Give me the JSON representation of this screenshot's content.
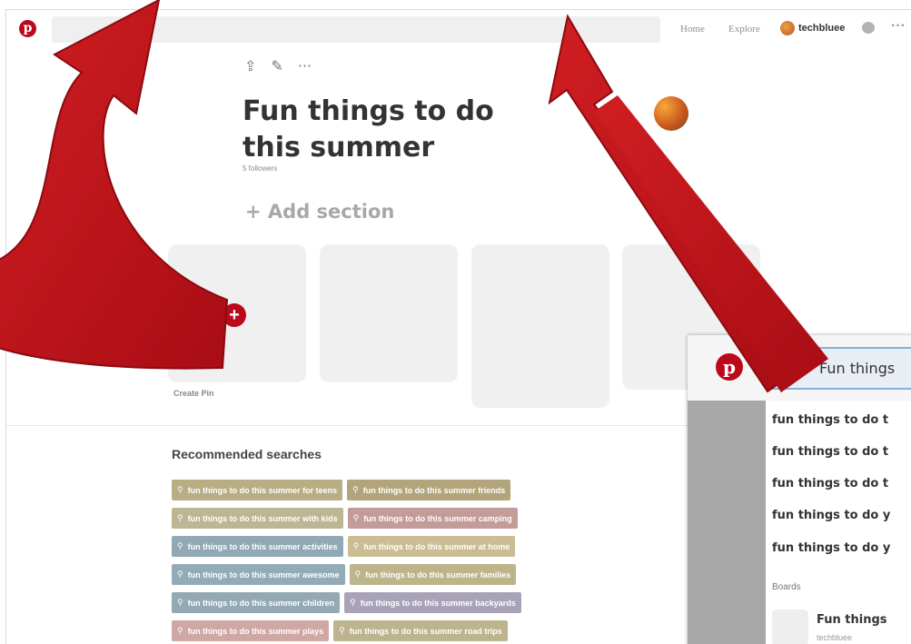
{
  "nav": {
    "logo_glyph": "p",
    "home": "Home",
    "explore": "Explore",
    "username": "techbluee",
    "more": "···"
  },
  "board": {
    "tools": [
      "⇪",
      "✎",
      "···"
    ],
    "title": "Fun things to do this summer",
    "followers": "5 followers",
    "add_section": "+ Add section",
    "create_pin": "Create Pin",
    "add_glyph": "+"
  },
  "recommended": {
    "title": "Recommended searches",
    "search_glyph": "⚲",
    "rows": [
      [
        {
          "label": "fun things to do this summer for teens",
          "color": "#b9ad84"
        },
        {
          "label": "fun things to do this summer friends",
          "color": "#b3a57b"
        }
      ],
      [
        {
          "label": "fun things to do this summer with kids",
          "color": "#bcb692"
        },
        {
          "label": "fun things to do this summer camping",
          "color": "#c39b98"
        }
      ],
      [
        {
          "label": "fun things to do this summer activities",
          "color": "#90a9b5"
        },
        {
          "label": "fun things to do this summer at home",
          "color": "#cbbd93"
        }
      ],
      [
        {
          "label": "fun things to do this summer awesome",
          "color": "#93abb6"
        },
        {
          "label": "fun things to do this summer families",
          "color": "#bcb48a"
        }
      ],
      [
        {
          "label": "fun things to do this summer children",
          "color": "#93a9b3"
        },
        {
          "label": "fun things to do this summer backyards",
          "color": "#a9a3b9"
        }
      ],
      [
        {
          "label": "fun things to do this summer plays",
          "color": "#cfa7a3"
        },
        {
          "label": "fun things to do this summer road trips",
          "color": "#bcb48c"
        }
      ]
    ]
  },
  "inset": {
    "logo_glyph": "p",
    "search_text": "Fun things",
    "suggestions": [
      "fun things to do t",
      "fun things to do t",
      "fun things to do t",
      "fun things to do y",
      "fun things to do y"
    ],
    "boards_label": "Boards",
    "board_name": "Fun things",
    "board_user": "techbluee"
  },
  "colors": {
    "brand_red": "#bd081c",
    "arrow_red": "#c4141c"
  }
}
